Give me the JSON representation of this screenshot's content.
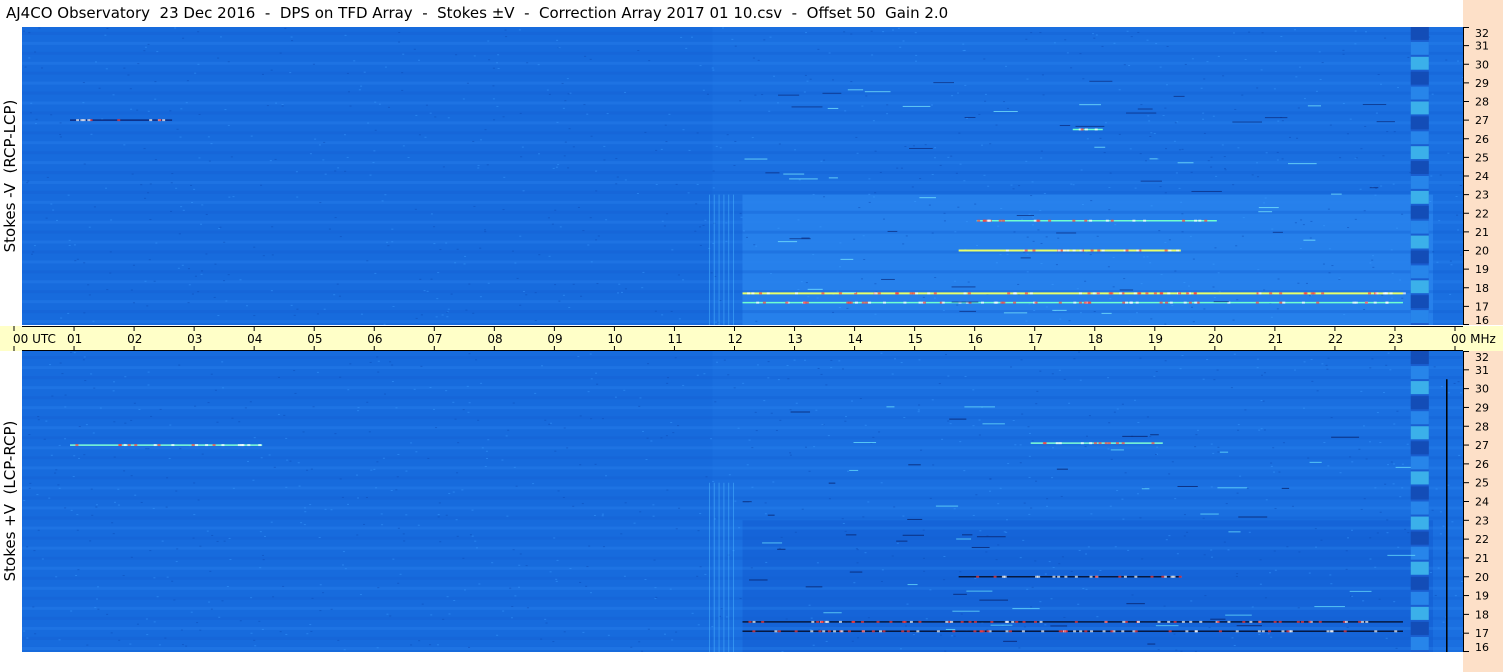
{
  "title": "AJ4CO Observatory  23 Dec 2016  -  DPS on TFD Array  -  Stokes ±V  -  Correction Array 2017 01 10.csv  -  Offset 50  Gain 2.0",
  "colors": {
    "background": "#1a6fe0",
    "time_bar": "#ffffc8",
    "freq_strip": "#fde0c8"
  },
  "chart_data": [
    {
      "type": "heatmap",
      "panel": "top",
      "ylabel": "Stokes -V  (RCP-LCP)",
      "x_unit": "UTC",
      "x_ticks": [
        "00",
        "01",
        "02",
        "03",
        "04",
        "05",
        "06",
        "07",
        "08",
        "09",
        "10",
        "11",
        "12",
        "13",
        "14",
        "15",
        "16",
        "17",
        "18",
        "19",
        "20",
        "21",
        "22",
        "23",
        "00"
      ],
      "xlim": [
        0,
        24
      ],
      "y_unit": "MHz",
      "y_ticks": [
        16,
        17,
        18,
        19,
        20,
        21,
        22,
        23,
        24,
        25,
        26,
        27,
        28,
        29,
        30,
        31,
        32
      ],
      "ylim": [
        16,
        32
      ],
      "features": [
        {
          "freq": 17.7,
          "t_start": 12.0,
          "t_end": 23.0,
          "intensity": "high"
        },
        {
          "freq": 17.2,
          "t_start": 12.0,
          "t_end": 23.0,
          "intensity": "medium"
        },
        {
          "freq": 20.0,
          "t_start": 15.6,
          "t_end": 19.3,
          "intensity": "high"
        },
        {
          "freq": 21.6,
          "t_start": 15.9,
          "t_end": 19.9,
          "intensity": "medium"
        },
        {
          "freq": 27.0,
          "t_start": 0.8,
          "t_end": 2.5,
          "intensity": "low"
        },
        {
          "freq": 26.5,
          "t_start": 17.5,
          "t_end": 18.0,
          "intensity": "medium"
        }
      ]
    },
    {
      "type": "heatmap",
      "panel": "bottom",
      "ylabel": "Stokes +V  (LCP-RCP)",
      "x_unit": "UTC",
      "x_ticks": [
        "00",
        "01",
        "02",
        "03",
        "04",
        "05",
        "06",
        "07",
        "08",
        "09",
        "10",
        "11",
        "12",
        "13",
        "14",
        "15",
        "16",
        "17",
        "18",
        "19",
        "20",
        "21",
        "22",
        "23",
        "00"
      ],
      "xlim": [
        0,
        24
      ],
      "y_unit": "MHz",
      "y_ticks": [
        16,
        17,
        18,
        19,
        20,
        21,
        22,
        23,
        24,
        25,
        26,
        27,
        28,
        29,
        30,
        31,
        32
      ],
      "ylim": [
        16,
        32
      ],
      "features": [
        {
          "freq": 20.0,
          "t_start": 15.6,
          "t_end": 19.3,
          "intensity": "low"
        },
        {
          "freq": 17.6,
          "t_start": 12.0,
          "t_end": 23.0,
          "intensity": "low"
        },
        {
          "freq": 17.1,
          "t_start": 12.0,
          "t_end": 23.0,
          "intensity": "low"
        },
        {
          "freq": 27.0,
          "t_start": 0.8,
          "t_end": 4.0,
          "intensity": "medium"
        },
        {
          "freq": 27.1,
          "t_start": 16.8,
          "t_end": 19.0,
          "intensity": "medium"
        }
      ]
    }
  ],
  "time_axis": {
    "first_label": "00  UTC",
    "labels": [
      "01",
      "02",
      "03",
      "04",
      "05",
      "06",
      "07",
      "08",
      "09",
      "10",
      "11",
      "12",
      "13",
      "14",
      "15",
      "16",
      "17",
      "18",
      "19",
      "20",
      "21",
      "22",
      "23"
    ],
    "last_label": "00 MHz"
  }
}
